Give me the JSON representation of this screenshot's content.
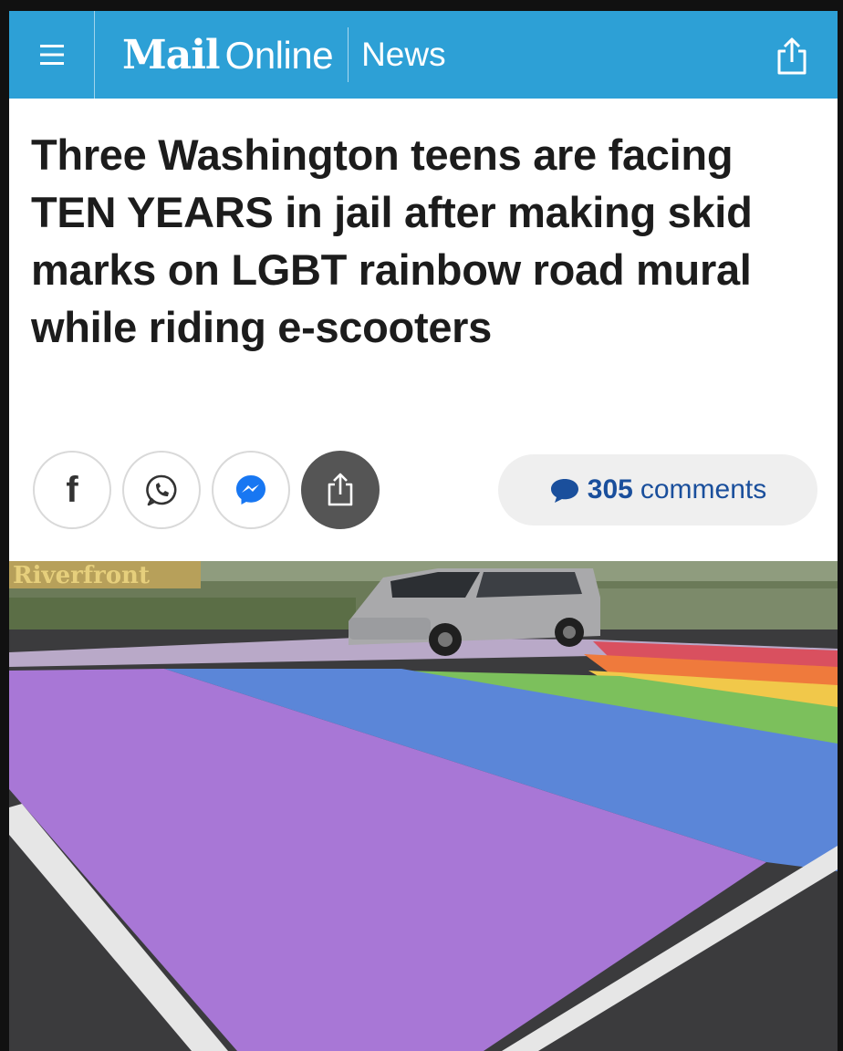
{
  "header": {
    "logo_mail": "Mail",
    "logo_online": "Online",
    "section": "News",
    "brand_color": "#2da0d6",
    "menu_icon": "hamburger-menu-icon",
    "share_icon": "share-icon"
  },
  "article": {
    "headline": "Three Washington teens are facing TEN YEARS in jail after making skid marks on LGBT rainbow road mural while riding e-scooters"
  },
  "social": {
    "buttons": [
      "facebook-icon",
      "whatsapp-icon",
      "messenger-icon",
      "share-icon"
    ],
    "comments_count": "305",
    "comments_label": "comments",
    "link_color": "#1a4f9c"
  },
  "photo": {
    "sign_text": "Riverfront"
  }
}
